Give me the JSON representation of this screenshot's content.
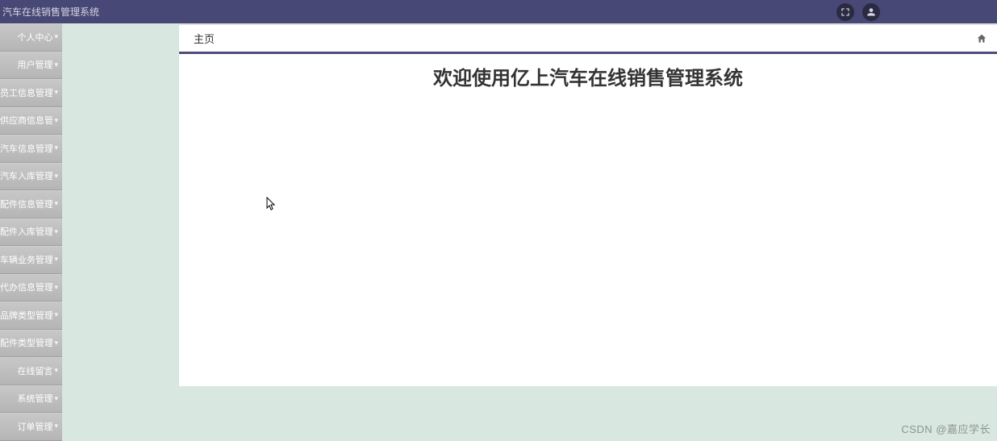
{
  "header": {
    "title": "汽车在线销售管理系统"
  },
  "sidebar": {
    "items": [
      {
        "label": "个人中心"
      },
      {
        "label": "用户管理"
      },
      {
        "label": "员工信息管理"
      },
      {
        "label": "供应商信息管理"
      },
      {
        "label": "汽车信息管理"
      },
      {
        "label": "汽车入库管理"
      },
      {
        "label": "配件信息管理"
      },
      {
        "label": "配件入库管理"
      },
      {
        "label": "车辆业务管理"
      },
      {
        "label": "代办信息管理"
      },
      {
        "label": "品牌类型管理"
      },
      {
        "label": "配件类型管理"
      },
      {
        "label": "在线留言"
      },
      {
        "label": "系统管理"
      },
      {
        "label": "订单管理"
      }
    ]
  },
  "tabs": {
    "active": "主页"
  },
  "main": {
    "welcome": "欢迎使用亿上汽车在线销售管理系统"
  },
  "watermark": "CSDN @嘉应学长"
}
